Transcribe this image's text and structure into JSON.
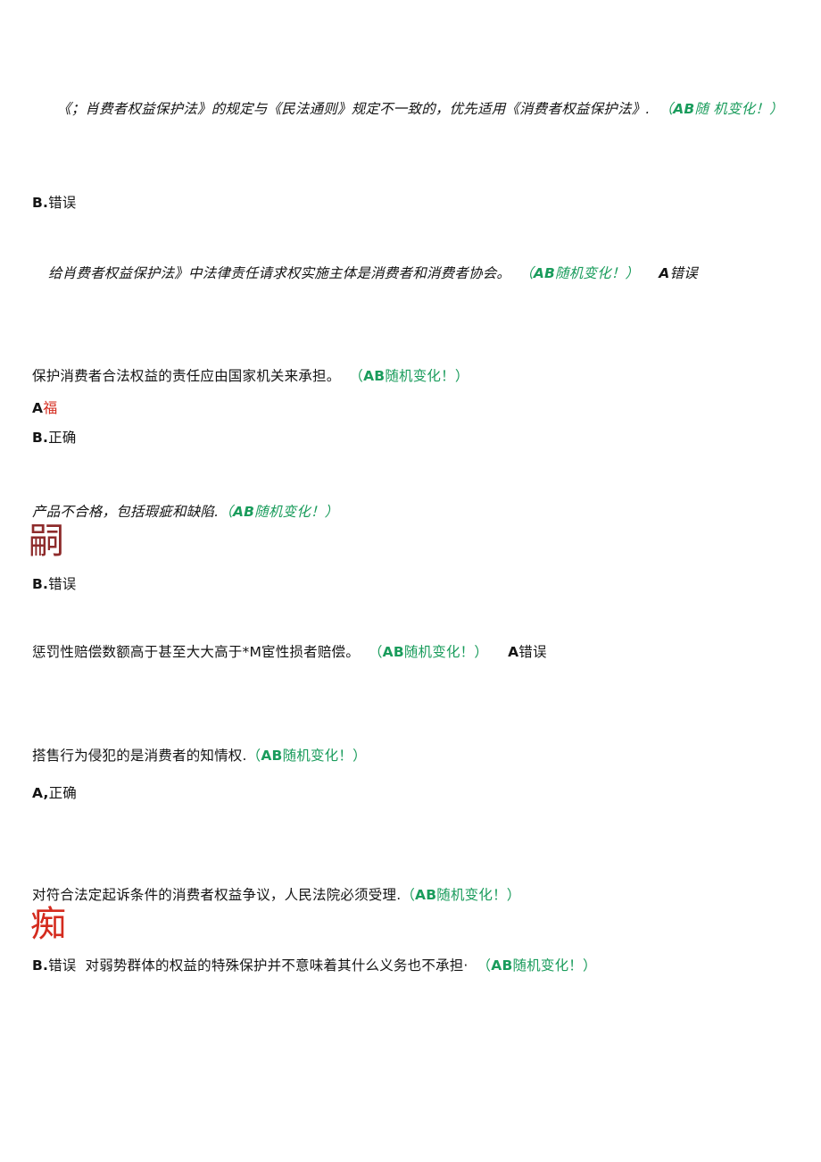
{
  "document": {
    "type": "scanned-exam-page",
    "language": "zh-CN",
    "colors": {
      "text": "#141414",
      "marker_green": "#1a9c5c",
      "marker_red": "#d42b1e",
      "stamp_red": "#8e2b2b"
    }
  },
  "items": [
    {
      "id": "item-1",
      "question": "《；肖费者权益保护法》的规定与《民法通则》规定不一致的，优先适用《消费者权益保护法》.",
      "tag_open": "（",
      "tag_ab": "AB",
      "tag_text": "随 机变化！",
      "tag_close": "）",
      "options": [
        {
          "label": "B.",
          "text": "错误"
        }
      ]
    },
    {
      "id": "item-2",
      "question": "给肖费者权益保护法》中法律责任请求权实施主体是消费者和消费者协会。",
      "tag_open": "（",
      "tag_ab": "AB",
      "tag_text": "随机变化！",
      "tag_close": "）",
      "inline_answer_label": "A",
      "inline_answer_text": "错误"
    },
    {
      "id": "item-3",
      "question": "保护消费者合法权益的责任应由国家机关来承担。",
      "tag_open": "（",
      "tag_ab": "AB",
      "tag_text": "随机变化！",
      "tag_close": "）",
      "options": [
        {
          "label": "A",
          "text": "",
          "red_mark": "福"
        },
        {
          "label": "B.",
          "text": "正确"
        }
      ]
    },
    {
      "id": "item-4",
      "question": "产品不合格，包括瑕疵和缺陷.",
      "tag_open": "（",
      "tag_ab": "AB",
      "tag_text": "随机变化！",
      "tag_close": "）",
      "stamp": "嗣",
      "options": [
        {
          "label": "B.",
          "text": "错误"
        }
      ]
    },
    {
      "id": "item-5",
      "question": "惩罚性赔偿数额高于甚至大大高于*M宦性损者赔偿。",
      "tag_open": "（",
      "tag_ab": "AB",
      "tag_text": "随机变化！",
      "tag_close": "）",
      "inline_answer_label": "A",
      "inline_answer_text": "错误"
    },
    {
      "id": "item-6",
      "question": "搭售行为侵犯的是消费者的知情权.",
      "tag_open": "（",
      "tag_ab": "AB",
      "tag_text": "随机变化！",
      "tag_close": "）",
      "options": [
        {
          "label": "A,",
          "text": "正确"
        }
      ]
    },
    {
      "id": "item-7",
      "question": "对符合法定起诉条件的消费者权益争议，人民法院必须受理.",
      "tag_open": "（",
      "tag_ab": "AB",
      "tag_text": "随机变化！",
      "tag_close": "）",
      "stamp": "痴",
      "options": [
        {
          "label": "B.",
          "text": "错误"
        }
      ],
      "trailing_question": "对弱势群体的权益的特殊保护并不意味着其什么义务也不承担·",
      "trailing_tag_open": "（",
      "trailing_tag_ab": "AB",
      "trailing_tag_text": "随机变化！",
      "trailing_tag_close": "）"
    }
  ]
}
